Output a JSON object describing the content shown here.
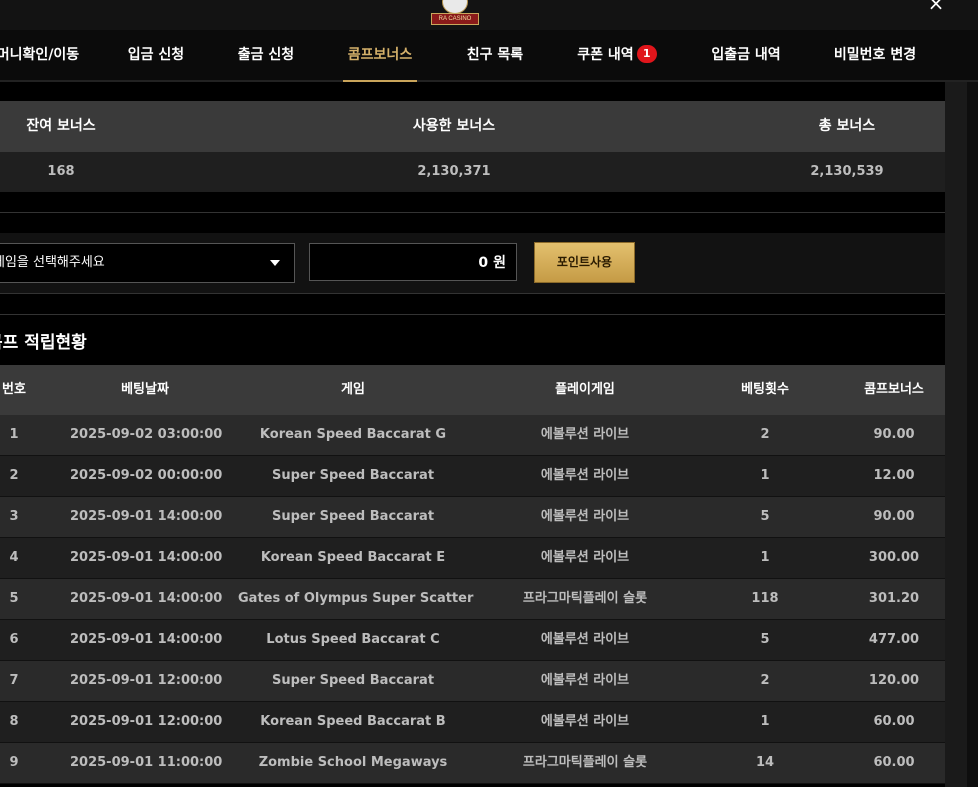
{
  "logo": {
    "text": "RA CASINO"
  },
  "close_label": "×",
  "tabs": [
    {
      "label": "머니확인/이동"
    },
    {
      "label": "입금 신청"
    },
    {
      "label": "출금 신청"
    },
    {
      "label": "콤프보너스",
      "active": true
    },
    {
      "label": "친구 목록"
    },
    {
      "label": "쿠폰 내역",
      "badge": "1"
    },
    {
      "label": "입출금 내역"
    },
    {
      "label": "비밀번호 변경"
    }
  ],
  "summary": {
    "headers": [
      "잔여 보너스",
      "사용한 보너스",
      "총 보너스"
    ],
    "values": [
      "168",
      "2,130,371",
      "2,130,539"
    ]
  },
  "form": {
    "select_value": "게임을 선택해주세요",
    "amount_value": "0",
    "amount_unit": "원",
    "submit_label": "포인트사용"
  },
  "history": {
    "title": "콤프 적립현황",
    "columns": [
      "번호",
      "베팅날짜",
      "게임",
      "플레이게임",
      "베팅횟수",
      "콤프보너스"
    ],
    "rows": [
      [
        "1",
        "2025-09-02 03:00:00",
        "Korean Speed Baccarat G",
        "에볼루션 라이브",
        "2",
        "90.00"
      ],
      [
        "2",
        "2025-09-02 00:00:00",
        "Super Speed Baccarat",
        "에볼루션 라이브",
        "1",
        "12.00"
      ],
      [
        "3",
        "2025-09-01 14:00:00",
        "Super Speed Baccarat",
        "에볼루션 라이브",
        "5",
        "90.00"
      ],
      [
        "4",
        "2025-09-01 14:00:00",
        "Korean Speed Baccarat E",
        "에볼루션 라이브",
        "1",
        "300.00"
      ],
      [
        "5",
        "2025-09-01 14:00:00",
        "Gates of Olympus Super Scatter",
        "프라그마틱플레이 슬롯",
        "118",
        "301.20"
      ],
      [
        "6",
        "2025-09-01 14:00:00",
        "Lotus Speed Baccarat C",
        "에볼루션 라이브",
        "5",
        "477.00"
      ],
      [
        "7",
        "2025-09-01 12:00:00",
        "Super Speed Baccarat",
        "에볼루션 라이브",
        "2",
        "120.00"
      ],
      [
        "8",
        "2025-09-01 12:00:00",
        "Korean Speed Baccarat B",
        "에볼루션 라이브",
        "1",
        "60.00"
      ],
      [
        "9",
        "2025-09-01 11:00:00",
        "Zombie School Megaways",
        "프라그마틱플레이 슬롯",
        "14",
        "60.00"
      ]
    ]
  },
  "colors": {
    "accent_gold": "#c9a45a",
    "badge_red": "#e0151b",
    "header_bg": "#3a3a3a"
  }
}
